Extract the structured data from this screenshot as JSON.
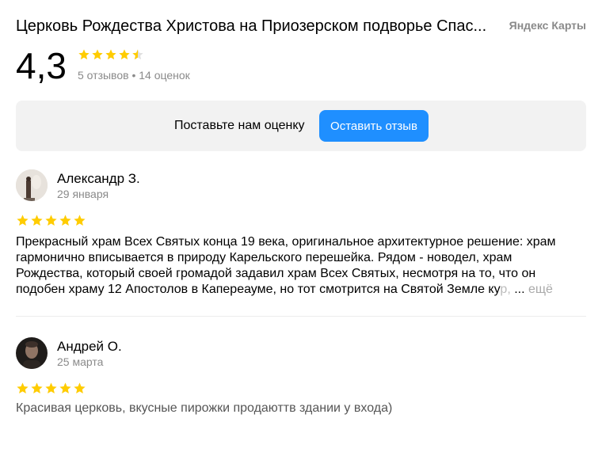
{
  "header": {
    "title": "Церковь Рождества Христова на Приозерском подворье Спасо-Преображенского Валаамского монастыря",
    "title_display": "Церковь Рождества Христова на Приозерском подворье Спас...",
    "brand": "Яндекс Карты"
  },
  "rating": {
    "value": "4,3",
    "stars_value": 4.3,
    "meta": "5 отзывов • 14 оценок"
  },
  "cta": {
    "text": "Поставьте нам оценку",
    "button": "Оставить отзыв"
  },
  "colors": {
    "star": "#ffcc00",
    "accent": "#1f8fff",
    "muted": "#8a8a8a",
    "panel": "#f2f2f2"
  },
  "reviews": [
    {
      "author": "Александр З.",
      "date": "29 января",
      "stars": 5,
      "text": "Прекрасный храм Всех Святых конца 19 века, оригинальное архитектурное решение: храм гармонично вписывается в природу Карельского перешейка. Рядом - новодел, храм Рождества, который своей громадой задавил храм Всех Святых, несмотря на то, что он подобен храму 12 Апостолов в Капереауме, но тот смотрится на Святой Земле ку",
      "text_fade": "р,",
      "ellipsis": " ...",
      "more": " ещё",
      "avatar_icon": "person-photo-avatar"
    },
    {
      "author": "Андрей О.",
      "date": "25 марта",
      "stars": 5,
      "text": "Красивая церковь, вкусные пирожки продаютт­в здании у входа)",
      "avatar_icon": "person-photo-avatar"
    }
  ]
}
